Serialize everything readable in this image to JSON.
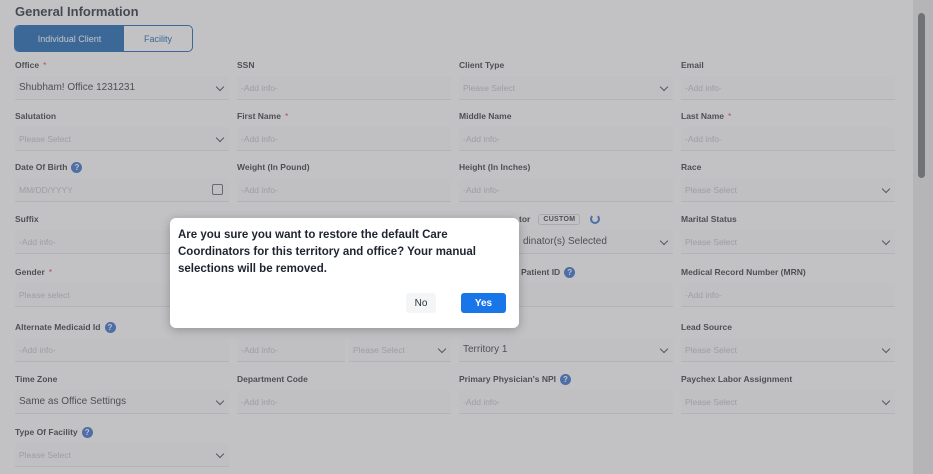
{
  "section_title": "General Information",
  "client_toggle": {
    "individual": "Individual Client",
    "facility": "Facility"
  },
  "fields": {
    "office": {
      "label": "Office",
      "req": "*",
      "value": "Shubham! Office 1231231"
    },
    "ssn": {
      "label": "SSN",
      "placeholder": "-Add info-"
    },
    "client_type": {
      "label": "Client Type",
      "placeholder": "Please Select"
    },
    "email": {
      "label": "Email",
      "placeholder": "-Add info-"
    },
    "salutation": {
      "label": "Salutation",
      "placeholder": "Please Select"
    },
    "first_name": {
      "label": "First Name",
      "req": "*",
      "placeholder": "-Add info-"
    },
    "middle_name": {
      "label": "Middle Name",
      "placeholder": "-Add info-"
    },
    "last_name": {
      "label": "Last Name",
      "req": "*",
      "placeholder": "-Add info-"
    },
    "dob": {
      "label": "Date Of Birth",
      "placeholder": "MM/DD/YYYY"
    },
    "weight": {
      "label": "Weight (In Pound)",
      "placeholder": "-Add info-"
    },
    "height": {
      "label": "Height (In Inches)",
      "placeholder": "-Add info-"
    },
    "race": {
      "label": "Race",
      "placeholder": "Please Select"
    },
    "suffix": {
      "label": "Suffix",
      "placeholder": "-Add info-"
    },
    "coordinator": {
      "label_fragment": "tor",
      "badge": "CUSTOM",
      "value": "dinator(s) Selected"
    },
    "marital_status": {
      "label": "Marital Status",
      "placeholder": "Please Select"
    },
    "gender": {
      "label": "Gender",
      "req": "*",
      "placeholder": "Please select"
    },
    "patient_id": {
      "label": "Patient ID",
      "placeholder": ""
    },
    "mrn": {
      "label": "Medical Record Number (MRN)",
      "placeholder": "-Add info-"
    },
    "alt_medicaid": {
      "label": "Alternate Medicaid Id",
      "placeholder": "-Add info-"
    },
    "middle_combo": {
      "left_placeholder": "-Add info-",
      "right_placeholder": "Please Select"
    },
    "territory": {
      "value": "Territory 1"
    },
    "lead_source": {
      "label": "Lead Source",
      "placeholder": "Please Select"
    },
    "time_zone": {
      "label": "Time Zone",
      "value": "Same as Office Settings"
    },
    "department_code": {
      "label": "Department Code",
      "placeholder": "-Add info-"
    },
    "primary_npi": {
      "label": "Primary Physician's NPI",
      "placeholder": "-Add info-"
    },
    "paychex": {
      "label": "Paychex Labor Assignment",
      "placeholder": "Please Select"
    },
    "facility_type": {
      "label": "Type Of Facility",
      "placeholder": "Please Select"
    }
  },
  "modal": {
    "message": "Are you sure you want to restore the default Care Coordinators for this territory and office? Your manual selections will be removed.",
    "no_label": "No",
    "yes_label": "Yes"
  },
  "colors": {
    "primary": "#0b5cad",
    "yes_button": "#1976e8",
    "help_icon": "#2a67c9"
  }
}
